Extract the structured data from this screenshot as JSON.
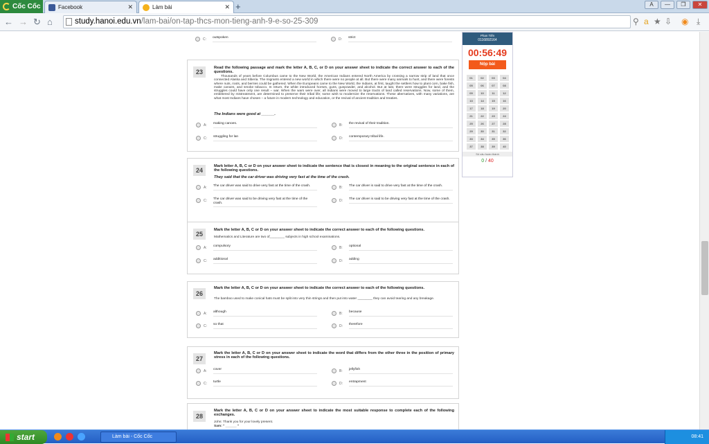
{
  "browser": {
    "logo": "Cốc Cốc",
    "tabs": [
      {
        "label": "Facebook"
      },
      {
        "label": "Làm bài"
      }
    ],
    "url_domain": "study.hanoi.edu.vn",
    "url_path": "/lam-bai/on-tap-thcs-mon-tieng-anh-9-e-so-25-309",
    "new_tab": "+",
    "window_buttons": [
      "A",
      "—",
      "❐",
      "✕"
    ]
  },
  "panel": {
    "name": "Phan Tiến",
    "id": "0116892164",
    "timer": "00:56:49",
    "submit": "Nộp bài",
    "grid": [
      "01",
      "02",
      "03",
      "04",
      "05",
      "06",
      "07",
      "08",
      "09",
      "10",
      "11",
      "12",
      "13",
      "14",
      "15",
      "16",
      "17",
      "18",
      "19",
      "20",
      "21",
      "22",
      "23",
      "24",
      "25",
      "26",
      "27",
      "28",
      "29",
      "30",
      "31",
      "32",
      "33",
      "34",
      "35",
      "36",
      "37",
      "38",
      "39",
      "40"
    ],
    "footer": "Số câu hoàn thành",
    "done": "0",
    "total": "40"
  },
  "questions": {
    "q22": {
      "c": "outspoken",
      "d": "strict"
    },
    "q23": {
      "num": "23",
      "title": "Read the following passage and mark the letter A, B, C, or D on your answer sheet to indicate the correct answer to each of the questions.",
      "passage": "Thousands of years before Columbus came to the New World, the American Indians entered North America by crossing a narrow strip of land that once connected Alaska and Siberia. The migrants entered a new world in which there were no people at all. But there were many animals to hunt, and there were forests where nuts, roots, and berries could be gathered. When the Europeans came to the New World, the Indians, at first, taught the settlers how to plant corn, bake fish, make canoes, and smoke tobacco. In return, the white introduced horses, guns, gunpowder, and alcohol. But at last, there were struggles for land, and the struggles could have only one result – war. When the wars were over, all Indians were moved to large tracts of land called reservations. Now, some of them, embittered by mistreatment, are determined to preserve their tribal life; some wish to modernize the reservations. These alternatives, with many variations, are what most Indians have chosen – a future in modern technology and education, or the revival of ancient tradition and treaties.",
      "prompt": "The Indians were good at ______.",
      "a": "making canoes.",
      "b": "the revival of their tradition.",
      "c": "struggling for lan",
      "d": "contemporary tribal life."
    },
    "q24": {
      "num": "24",
      "title": "Mark letter A, B, C or D on your answer sheet to indicate the sentence that is closest in meaning to the original sentence in each of the following questions.",
      "prompt": "They said that the car driver was driving very fast at the time of the crash.",
      "a": "The car driver was said to drive very fast at the time of the crash.",
      "b": "The car driver is said to drive very fast at the time of the crash.",
      "c": "The car driver was said to be driving very fast at the time of the crash.",
      "d": "The car driver is said to be driving very fast at the time of the crash."
    },
    "q25": {
      "num": "25",
      "title": "Mark the letter A, B, C or D on your answer sheet to indicate the correct answer to each of the following questions.",
      "stem": "Mathematics and Literature are two of________ subjects in high school examinations.",
      "a": "compulsory",
      "b": "optional",
      "c": "additional",
      "d": "adding"
    },
    "q26": {
      "num": "26",
      "title": "Mark the letter A, B, C or D on your answer sheet to indicate the correct answer to each of the following questions.",
      "stem": "The bamboo used to make conical hats must be split into very thin strings and then put into water ________ they can avoid tearing and any breakage.",
      "a": "although",
      "b": "because",
      "c": "so that",
      "d": "therefore"
    },
    "q27": {
      "num": "27",
      "title": "Mark the letter A, B, C or D on your answer sheet to indicate the word that differs from the other three in the position of primary stress in each of the following questions.",
      "a": "cover",
      "b": "jellyfish",
      "c": "turtle",
      "d": "entrapment"
    },
    "q28": {
      "num": "28",
      "title": "Mark the letter A, B, C or D on your answer sheet to indicate the most suitable response to complete each of the following exchanges.",
      "line1": "John: Thank you for your lovely present.",
      "line2": "Sam: \" ______ \""
    }
  },
  "letters": {
    "a": "A:",
    "b": "B:",
    "c": "C:",
    "d": "D:"
  },
  "taskbar": {
    "start": "start",
    "item": "Làm bài - Cốc Cốc",
    "time": "08:41"
  }
}
